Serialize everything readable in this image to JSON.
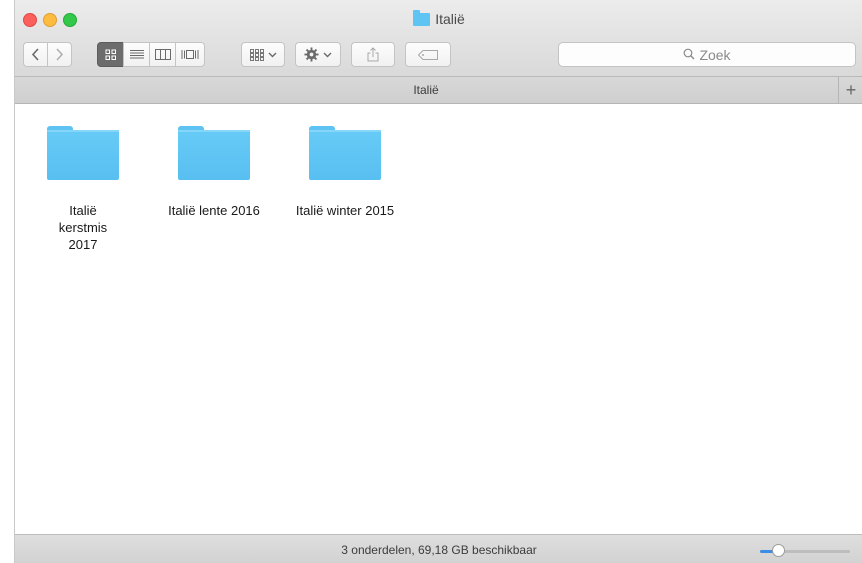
{
  "window": {
    "title": "Italië"
  },
  "toolbar": {
    "back_icon": "chevron-left-icon",
    "forward_icon": "chevron-right-icon",
    "view_modes": [
      "icon-view",
      "list-view",
      "column-view",
      "cover-flow-view"
    ],
    "active_view": "icon-view",
    "search_placeholder": "Zoek"
  },
  "tabbar": {
    "label": "Italië",
    "add_label": "+"
  },
  "items": [
    {
      "label": "Italië kerstmis 2017"
    },
    {
      "label": "Italië lente 2016"
    },
    {
      "label": "Italië winter 2015"
    }
  ],
  "status": {
    "text": "3 onderdelen, 69,18 GB beschikbaar",
    "zoom": 0.2
  },
  "colors": {
    "accent": "#3a8ee6",
    "folder": "#5ec3f2",
    "close": "#fc605c",
    "minimize": "#fdbc40",
    "maximize": "#34c84a"
  }
}
